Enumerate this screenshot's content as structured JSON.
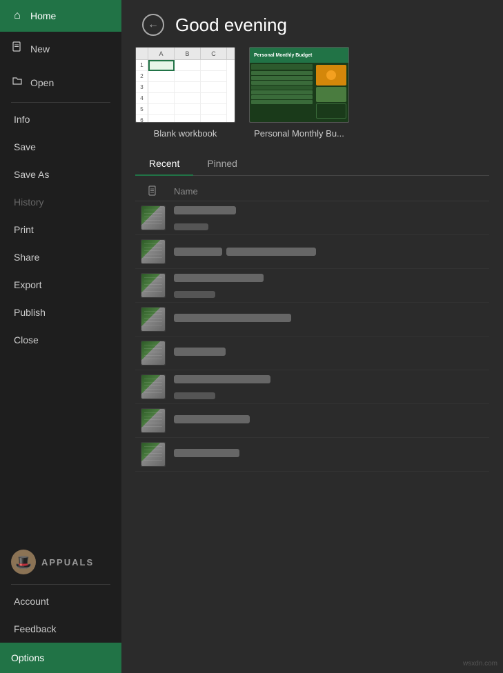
{
  "sidebar": {
    "home_label": "Home",
    "new_label": "New",
    "open_label": "Open",
    "divider_after_open": true,
    "info_label": "Info",
    "save_label": "Save",
    "save_as_label": "Save As",
    "history_label": "History",
    "print_label": "Print",
    "share_label": "Share",
    "export_label": "Export",
    "publish_label": "Publish",
    "close_label": "Close",
    "account_label": "Account",
    "feedback_label": "Feedback",
    "options_label": "Options"
  },
  "header": {
    "greeting": "Good evening",
    "back_icon": "←"
  },
  "templates": [
    {
      "id": "blank",
      "label": "Blank workbook"
    },
    {
      "id": "budget",
      "label": "Personal Monthly Bu..."
    }
  ],
  "tabs": [
    {
      "id": "recent",
      "label": "Recent",
      "active": true
    },
    {
      "id": "pinned",
      "label": "Pinned",
      "active": false
    }
  ],
  "file_list_header": {
    "name_col": "Name"
  },
  "files": [
    {
      "id": 1,
      "name_width": 90,
      "sub_width": 0
    },
    {
      "id": 2,
      "name_width": 70,
      "sub_width": 130
    },
    {
      "id": 3,
      "name_width": 130,
      "sub_width": 60
    },
    {
      "id": 4,
      "name_width": 150,
      "sub_width": 0
    },
    {
      "id": 5,
      "name_width": 75,
      "sub_width": 0
    },
    {
      "id": 6,
      "name_width": 140,
      "sub_width": 60
    },
    {
      "id": 7,
      "name_width": 110,
      "sub_width": 0
    },
    {
      "id": 8,
      "name_width": 95,
      "sub_width": 0
    }
  ],
  "watermark": "wsxdn.com",
  "colors": {
    "active_green": "#217346",
    "sidebar_bg": "#1e1e1e",
    "main_bg": "#2b2b2b"
  }
}
